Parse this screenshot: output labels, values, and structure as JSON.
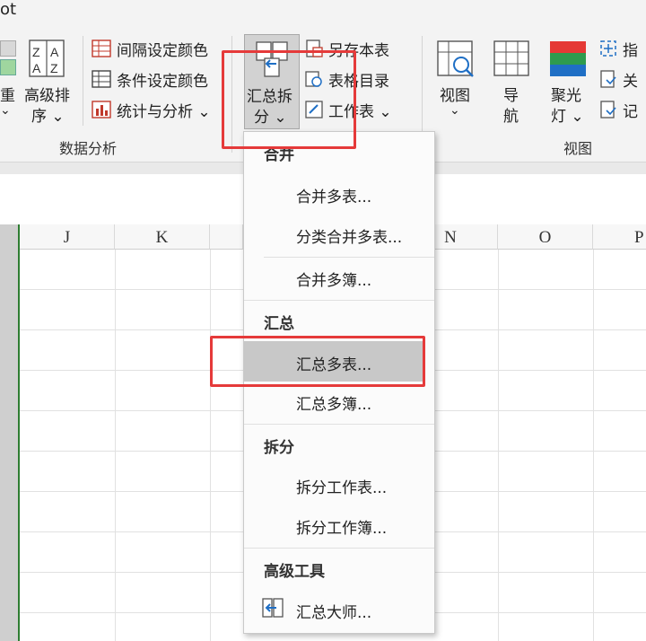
{
  "app": {
    "title_fragment": "ot"
  },
  "ribbon": {
    "left_partial": {
      "label1": "重",
      "label2": "⌄"
    },
    "advanced_sort": {
      "line1": "高级排",
      "line2": "序 ⌄"
    },
    "interval_color": "间隔设定颜色",
    "conditional_color": "条件设定颜色",
    "stats_analysis": "统计与分析 ⌄",
    "group_data_analysis": "数据分析",
    "summary_split": {
      "line1": "汇总拆",
      "line2": "分 ⌄"
    },
    "save_sheet": "另存本表",
    "table_directory": "表格目录",
    "worksheet": "工作表 ⌄",
    "view": {
      "line1": "视图",
      "line2": "⌄"
    },
    "navigation": {
      "line1": "导",
      "line2": "航"
    },
    "spotlight": {
      "line1": "聚光",
      "line2": "灯 ⌄"
    },
    "right_partial": [
      "指",
      "关",
      "记"
    ],
    "group_view": "视图"
  },
  "sheet": {
    "columns": [
      "J",
      "K",
      "N",
      "O",
      "P"
    ]
  },
  "menu": {
    "sections": [
      {
        "header": "合并",
        "items": [
          "合并多表...",
          "分类合并多表...",
          "合并多簿..."
        ]
      },
      {
        "header": "汇总",
        "items": [
          "汇总多表...",
          "汇总多簿..."
        ]
      },
      {
        "header": "拆分",
        "items": [
          "拆分工作表...",
          "拆分工作簿..."
        ]
      },
      {
        "header": "高级工具",
        "items": [
          "汇总大师..."
        ]
      }
    ]
  },
  "colors": {
    "highlight": "#e53a3a",
    "hover": "#c8c8c8",
    "selected_col": "#cfcfcf"
  }
}
